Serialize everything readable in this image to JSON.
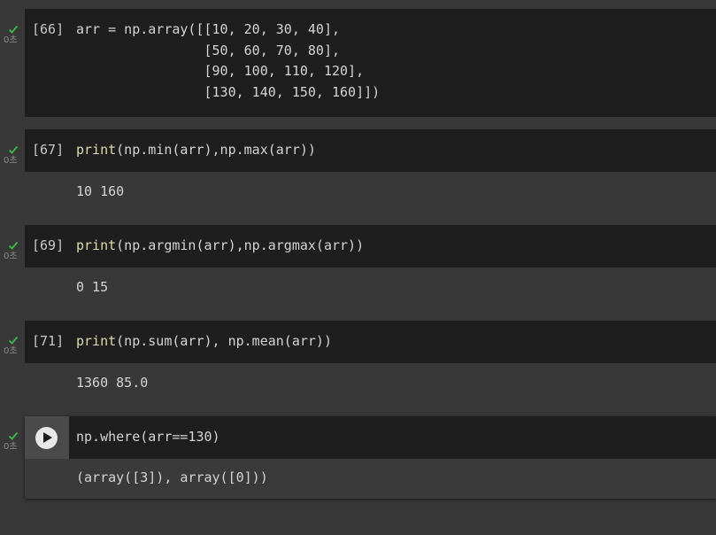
{
  "cells": [
    {
      "count": "[66]",
      "time": "0초",
      "code_lines": [
        "arr = np.array([[10, 20, 30, 40],",
        "                [50, 60, 70, 80],",
        "                [90, 100, 110, 120],",
        "                [130, 140, 150, 160]])"
      ],
      "output": ""
    },
    {
      "count": "[67]",
      "time": "0초",
      "code_fn": "print",
      "code_rest": "(np.min(arr),np.max(arr))",
      "output": "10 160"
    },
    {
      "count": "[69]",
      "time": "0초",
      "code_fn": "print",
      "code_rest": "(np.argmin(arr),np.argmax(arr))",
      "output": "0 15"
    },
    {
      "count": "[71]",
      "time": "0초",
      "code_fn": "print",
      "code_rest": "(np.sum(arr), np.mean(arr))",
      "output": "1360 85.0"
    },
    {
      "count": "",
      "time": "0초",
      "code": "np.where(arr==130)",
      "output": "(array([3]), array([0]))"
    }
  ],
  "icons": {
    "check": "check-icon",
    "run": "play-icon"
  },
  "colors": {
    "check": "#3fb950",
    "code_bg": "#1e1e1e",
    "page_bg": "#383838",
    "function": "#dcdcaa"
  }
}
